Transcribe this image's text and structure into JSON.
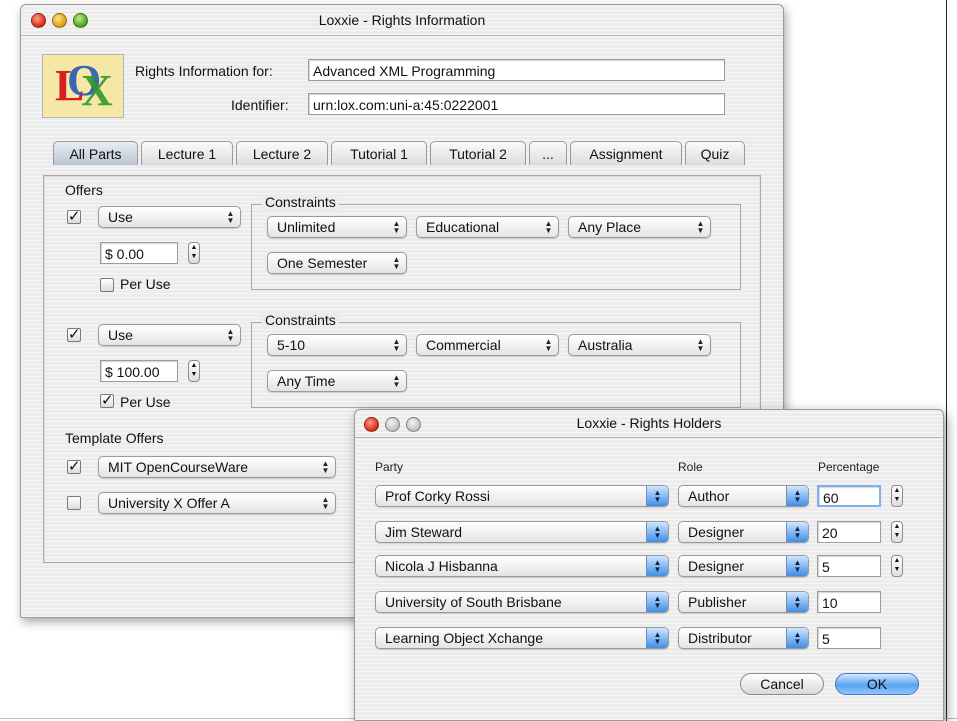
{
  "main_window": {
    "title": "Loxxie - Rights Information",
    "logo": {
      "icon": "lox-logo-icon"
    },
    "rights_info_label": "Rights Information for:",
    "rights_info_value": "Advanced XML Programming",
    "identifier_label": "Identifier:",
    "identifier_value": "urn:lox.com:uni-a:45:0222001",
    "tabs": [
      {
        "label": "All Parts",
        "active": true
      },
      {
        "label": "Lecture 1"
      },
      {
        "label": "Lecture 2"
      },
      {
        "label": "Tutorial 1"
      },
      {
        "label": "Tutorial 2"
      },
      {
        "label": "..."
      },
      {
        "label": "Assignment"
      },
      {
        "label": "Quiz"
      }
    ],
    "offers_label": "Offers",
    "offers": [
      {
        "checked": true,
        "action": "Use",
        "price": "$ 0.00",
        "per_use_label": "Per Use",
        "per_use_checked": false,
        "constraints_label": "Constraints",
        "constraints": [
          "Unlimited",
          "Educational",
          "Any Place",
          "One Semester"
        ]
      },
      {
        "checked": true,
        "action": "Use",
        "price": "$ 100.00",
        "per_use_label": "Per Use",
        "per_use_checked": true,
        "constraints_label": "Constraints",
        "constraints": [
          "5-10",
          "Commercial",
          "Australia",
          "Any Time"
        ]
      }
    ],
    "template_offers_label": "Template Offers",
    "template_offers": [
      {
        "checked": true,
        "value": "MIT OpenCourseWare"
      },
      {
        "checked": false,
        "value": "University X Offer A"
      }
    ]
  },
  "holders_window": {
    "title": "Loxxie - Rights Holders",
    "col_party": "Party",
    "col_role": "Role",
    "col_percentage": "Percentage",
    "rows": [
      {
        "party": "Prof Corky Rossi",
        "role": "Author",
        "percentage": "60"
      },
      {
        "party": "Jim Steward",
        "role": "Designer",
        "percentage": "20"
      },
      {
        "party": "Nicola J Hisbanna",
        "role": "Designer",
        "percentage": "5"
      },
      {
        "party": "University of South Brisbane",
        "role": "Publisher",
        "percentage": "10"
      },
      {
        "party": "Learning Object Xchange",
        "role": "Distributor",
        "percentage": "5"
      }
    ],
    "cancel_label": "Cancel",
    "ok_label": "OK"
  },
  "colors": {
    "accent": "#3f8ee6",
    "window_bg": "#ececec"
  }
}
